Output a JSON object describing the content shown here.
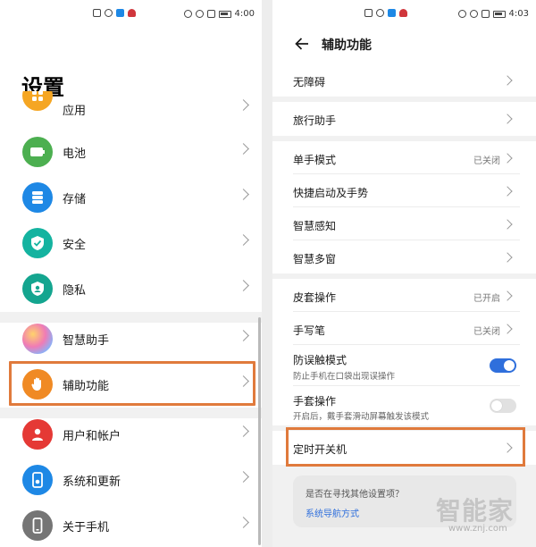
{
  "left": {
    "status": {
      "time": "4:00"
    },
    "title": "设置",
    "items": [
      {
        "label": "应用",
        "icon": "apps-icon",
        "color": "#f5a623"
      },
      {
        "label": "电池",
        "icon": "battery-icon",
        "color": "#4caf50"
      },
      {
        "label": "存储",
        "icon": "storage-icon",
        "color": "#1e88e5"
      },
      {
        "label": "安全",
        "icon": "shield-check-icon",
        "color": "#14b3a0"
      },
      {
        "label": "隐私",
        "icon": "privacy-icon",
        "color": "#14a58f"
      },
      {
        "label": "智慧助手",
        "icon": "smart-assistant-icon",
        "color": "#b57be0"
      },
      {
        "label": "辅助功能",
        "icon": "hand-icon",
        "color": "#f08a24"
      },
      {
        "label": "用户和帐户",
        "icon": "user-icon",
        "color": "#e53935"
      },
      {
        "label": "系统和更新",
        "icon": "system-update-icon",
        "color": "#1e88e5"
      },
      {
        "label": "关于手机",
        "icon": "phone-icon",
        "color": "#757575"
      }
    ]
  },
  "right": {
    "status": {
      "time": "4:03"
    },
    "header": {
      "title": "辅助功能"
    },
    "rows": [
      {
        "label": "无障碍"
      },
      {
        "label": "旅行助手"
      },
      {
        "label": "单手模式",
        "status": "已关闭"
      },
      {
        "label": "快捷启动及手势"
      },
      {
        "label": "智慧感知"
      },
      {
        "label": "智慧多窗"
      },
      {
        "label": "皮套操作",
        "status": "已开启"
      },
      {
        "label": "手写笔",
        "status": "已关闭"
      },
      {
        "label": "防误触模式",
        "sub": "防止手机在口袋出现误操作",
        "toggle": "on"
      },
      {
        "label": "手套操作",
        "sub": "开启后，戴手套滑动屏幕触发该模式",
        "toggle": "off"
      },
      {
        "label": "定时开关机"
      }
    ],
    "suggest": {
      "question": "是否在寻找其他设置项？",
      "link": "系统导航方式"
    }
  },
  "watermark": {
    "text": "智能家",
    "url": "www.znj.com"
  },
  "colors": {
    "highlight": "#e07a3c",
    "accent": "#2f6fdc"
  }
}
